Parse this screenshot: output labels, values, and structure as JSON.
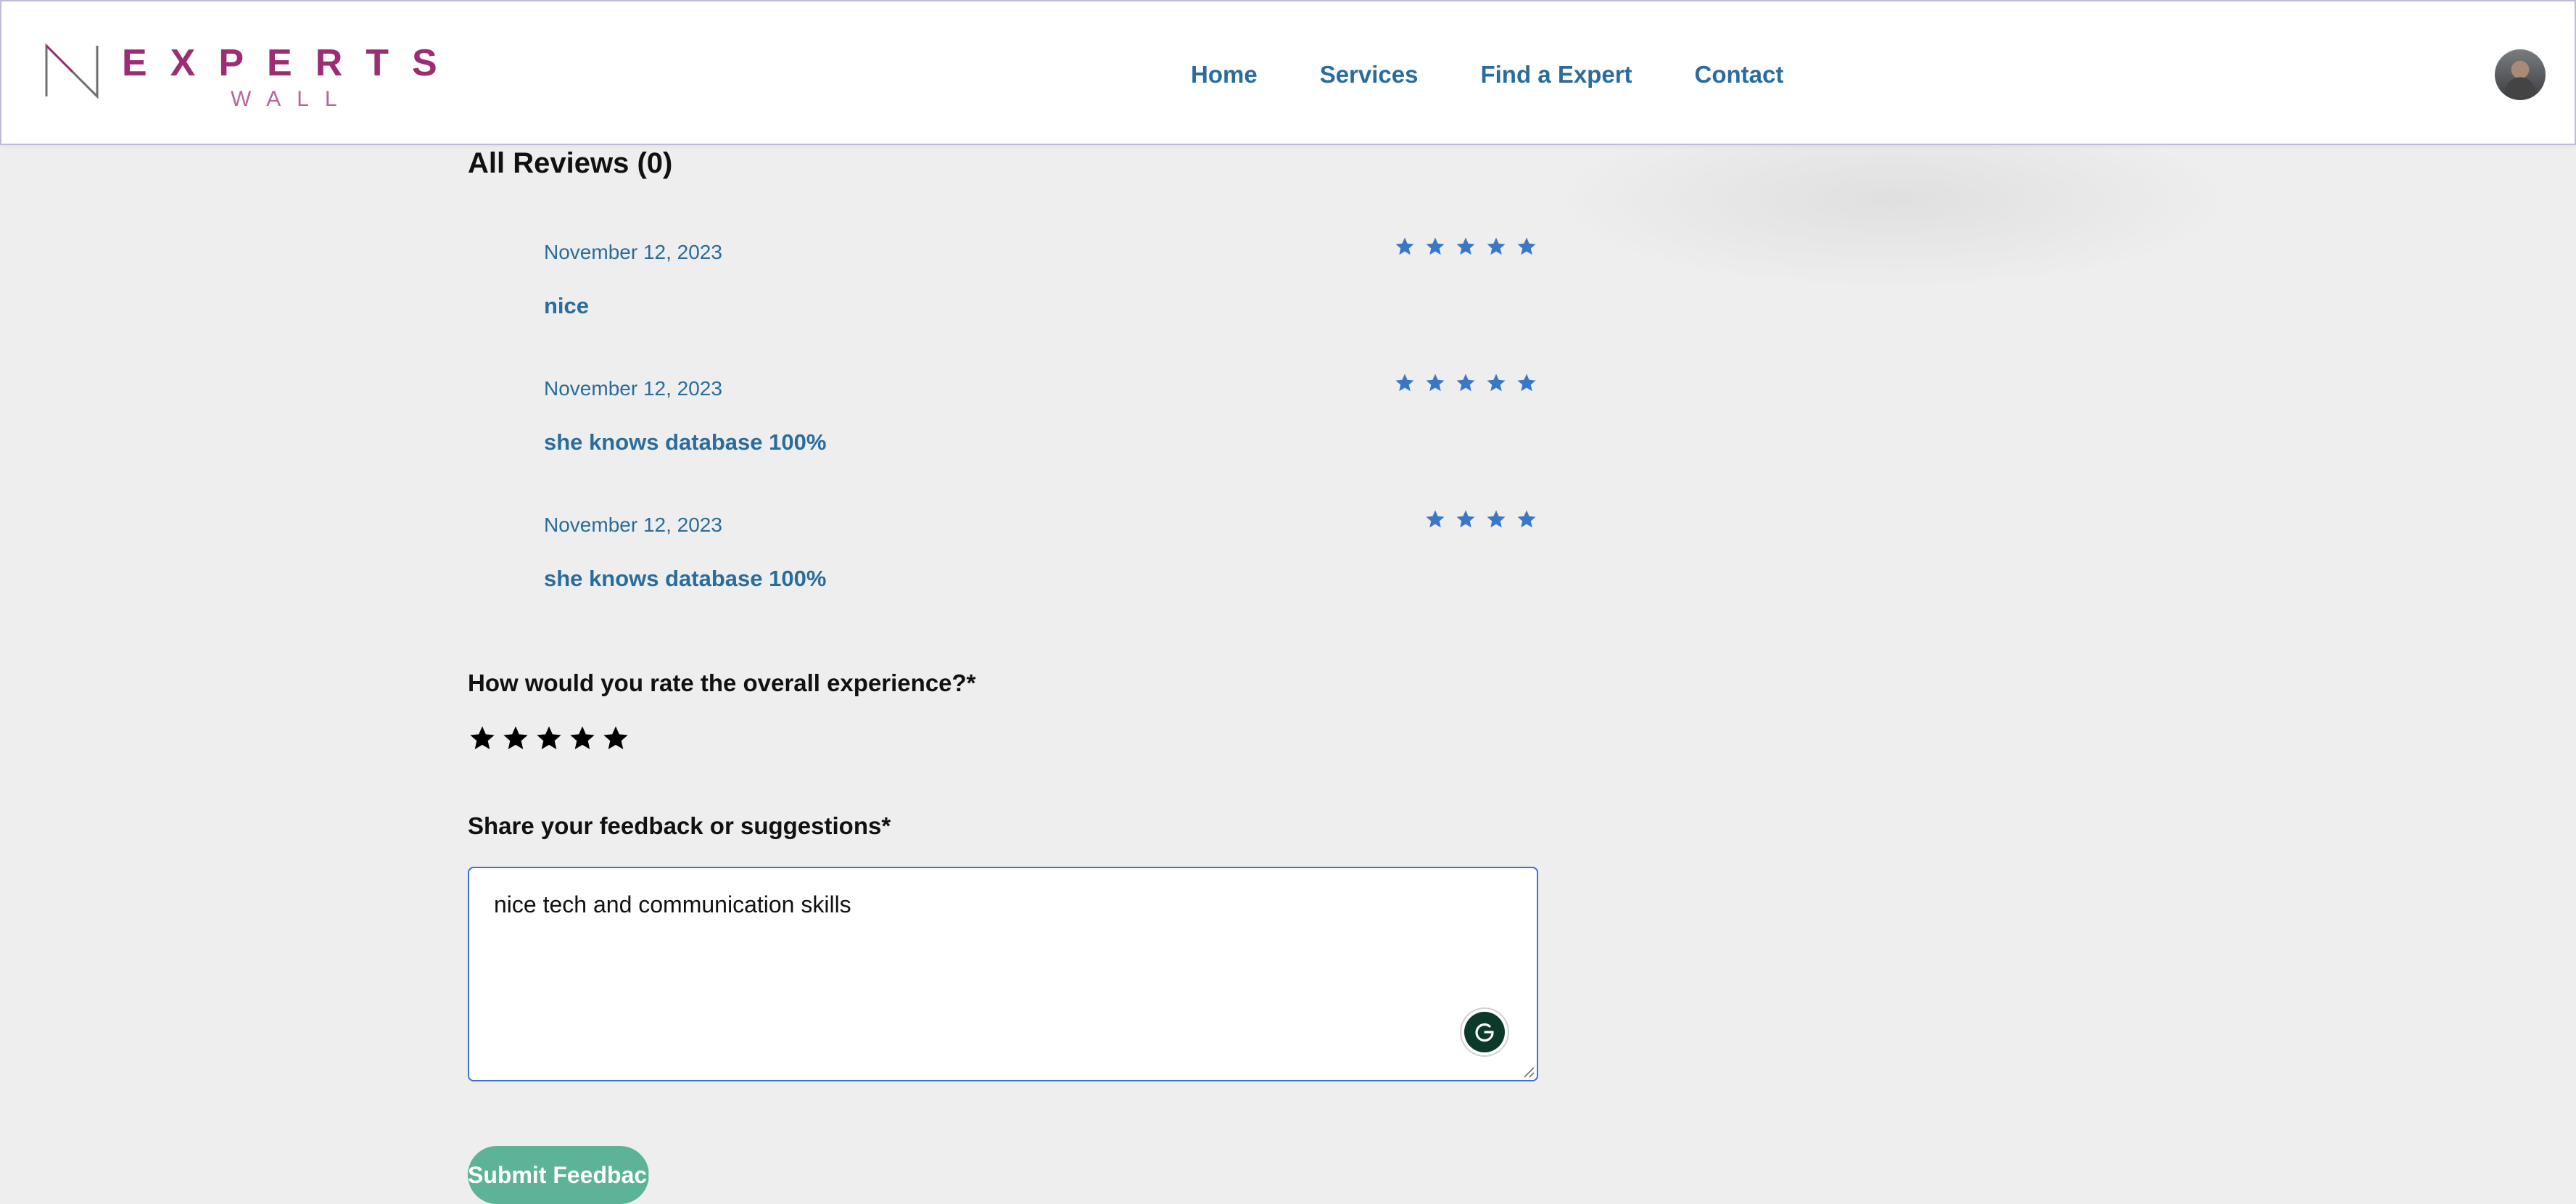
{
  "header": {
    "brand": {
      "name": "EXPERTS",
      "sub": "WALL"
    },
    "nav": [
      {
        "label": "Home"
      },
      {
        "label": "Services"
      },
      {
        "label": "Find a Expert"
      },
      {
        "label": "Contact"
      }
    ],
    "avatar_icon": "user-avatar"
  },
  "reviews": {
    "title": "All Reviews (0)",
    "items": [
      {
        "date": "November 12, 2023",
        "text": "nice",
        "rating": 5
      },
      {
        "date": "November 12, 2023",
        "text": "she knows database 100%",
        "rating": 5
      },
      {
        "date": "November 12, 2023",
        "text": "she knows database 100%",
        "rating": 4
      }
    ],
    "star_color": "#3a78c5"
  },
  "form": {
    "rating_label": "How would you rate the overall experience?*",
    "rating_value": 5,
    "feedback_label": "Share your feedback or suggestions*",
    "feedback_value": "nice tech and communication skills",
    "grammar_icon": "grammarly-icon",
    "submit_label": "Submit Feedback",
    "submit_color": "#5cb397"
  },
  "colors": {
    "brand": "#9c2d73",
    "link": "#2a6c9b",
    "background": "#eeeeee"
  }
}
